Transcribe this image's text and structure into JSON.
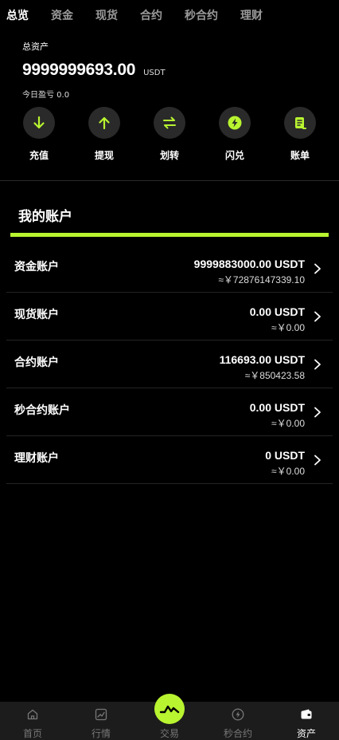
{
  "tabs": [
    {
      "label": "总览",
      "active": true
    },
    {
      "label": "资金"
    },
    {
      "label": "现货"
    },
    {
      "label": "合约"
    },
    {
      "label": "秒合约"
    },
    {
      "label": "理财"
    }
  ],
  "summary": {
    "label": "总资产",
    "value": "9999999693.00",
    "unit": "USDT",
    "pnl": "今日盈亏 0.0"
  },
  "actions": [
    {
      "label": "充值",
      "icon": "arrow-down-icon"
    },
    {
      "label": "提现",
      "icon": "arrow-up-icon"
    },
    {
      "label": "划转",
      "icon": "transfer-icon"
    },
    {
      "label": "闪兑",
      "icon": "flash-icon"
    },
    {
      "label": "账单",
      "icon": "bill-icon"
    }
  ],
  "my_accounts": {
    "title": "我的账户",
    "items": [
      {
        "name": "资金账户",
        "amount": "9999883000.00 USDT",
        "cny": "≈￥72876147339.10"
      },
      {
        "name": "现货账户",
        "amount": "0.00 USDT",
        "cny": "≈￥0.00"
      },
      {
        "name": "合约账户",
        "amount": "116693.00 USDT",
        "cny": "≈￥850423.58"
      },
      {
        "name": "秒合约账户",
        "amount": "0.00 USDT",
        "cny": "≈￥0.00"
      },
      {
        "name": "理财账户",
        "amount": "0 USDT",
        "cny": "≈￥0.00"
      }
    ]
  },
  "bottom_nav": [
    {
      "label": "首页",
      "icon": "home-icon"
    },
    {
      "label": "行情",
      "icon": "chart-icon"
    },
    {
      "label": "交易",
      "icon": "trade-icon"
    },
    {
      "label": "秒合约",
      "icon": "flash-circle-icon"
    },
    {
      "label": "资产",
      "icon": "wallet-icon",
      "active": true
    }
  ],
  "colors": {
    "accent": "#b8f430",
    "background": "#000000",
    "nav_bg": "#1c1c1c"
  }
}
